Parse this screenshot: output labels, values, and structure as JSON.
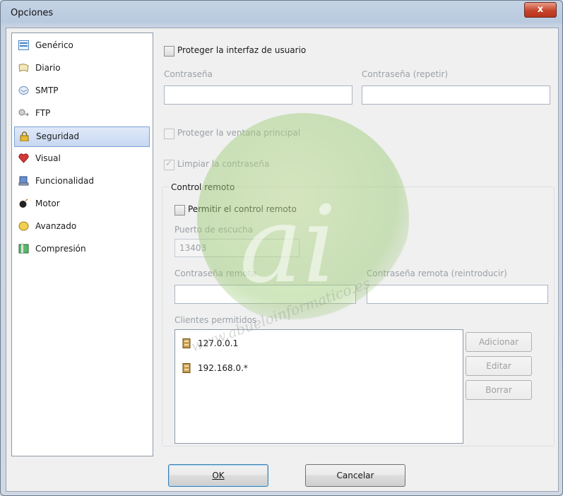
{
  "window": {
    "title": "Opciones",
    "close_label": "x"
  },
  "sidebar": {
    "items": [
      {
        "label": "Genérico",
        "icon": "generic-icon",
        "color": "#4a86c8"
      },
      {
        "label": "Diario",
        "icon": "diary-icon",
        "color": "#d8c48a"
      },
      {
        "label": "SMTP",
        "icon": "smtp-icon",
        "color": "#6a8fc0"
      },
      {
        "label": "FTP",
        "icon": "ftp-icon",
        "color": "#7a7a7a"
      },
      {
        "label": "Seguridad",
        "icon": "padlock-icon",
        "color": "#d8a820",
        "selected": true
      },
      {
        "label": "Visual",
        "icon": "heart-icon",
        "color": "#d23a3a"
      },
      {
        "label": "Funcionalidad",
        "icon": "functionality-icon",
        "color": "#3a5fa0"
      },
      {
        "label": "Motor",
        "icon": "engine-icon",
        "color": "#222222"
      },
      {
        "label": "Avanzado",
        "icon": "advanced-icon",
        "color": "#e8c040"
      },
      {
        "label": "Compresión",
        "icon": "compression-icon",
        "color": "#3a9a4a"
      }
    ]
  },
  "security": {
    "protect_ui_label": "Proteger la interfaz de usuario",
    "password_label": "Contraseña",
    "password_repeat_label": "Contraseña (repetir)",
    "protect_main_label": "Proteger la ventana principal",
    "clear_password_label": "Limpiar la contraseña"
  },
  "remote": {
    "group_title": "Control remoto",
    "allow_label": "Permitir el control remoto",
    "port_label": "Puerto de escucha",
    "port_value": "13403",
    "remote_password_label": "Contraseña remota",
    "remote_password_repeat_label": "Contraseña remota (reintroducir)",
    "clients_label": "Clientes permitidos",
    "clients": [
      {
        "address": "127.0.0.1",
        "icon": "client-icon"
      },
      {
        "address": "192.168.0.*",
        "icon": "client-icon"
      }
    ],
    "buttons": {
      "add": "Adicionar",
      "edit": "Editar",
      "delete": "Borrar"
    }
  },
  "footer": {
    "ok": "OK",
    "cancel": "Cancelar"
  },
  "watermark": {
    "letters": "ai",
    "url": "www.abueloinformatico.es"
  }
}
